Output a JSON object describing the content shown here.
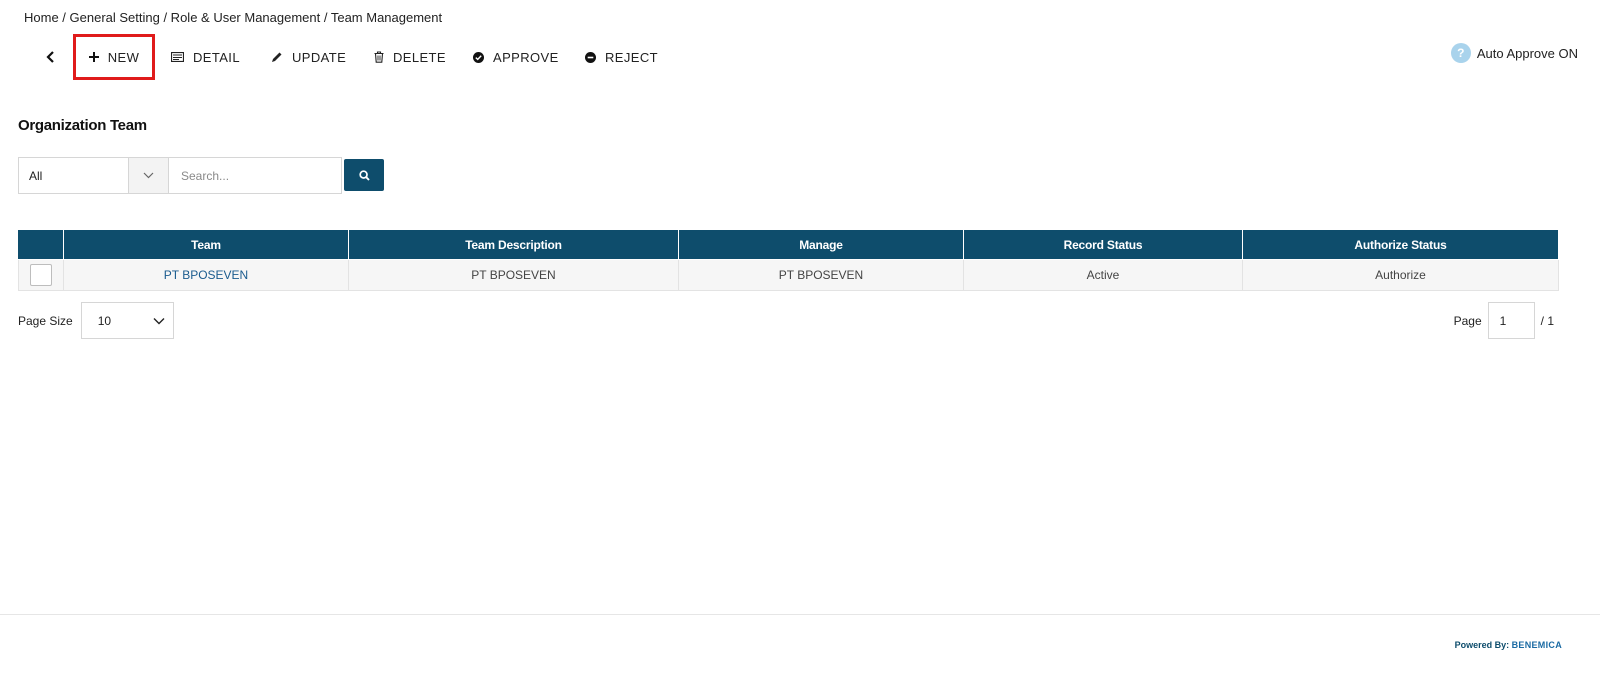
{
  "breadcrumb": "Home / General Setting / Role & User Management / Team Management",
  "toolbar": {
    "new_label": "NEW",
    "detail_label": "DETAIL",
    "update_label": "UPDATE",
    "delete_label": "DELETE",
    "approve_label": "APPROVE",
    "reject_label": "REJECT"
  },
  "auto_approve": {
    "icon": "?",
    "label": "Auto Approve ON"
  },
  "page_title": "Organization Team",
  "filter": {
    "selected": "All",
    "search_placeholder": "Search..."
  },
  "table": {
    "columns": [
      "Team",
      "Team Description",
      "Manage",
      "Record Status",
      "Authorize Status"
    ],
    "rows": [
      {
        "team": "PT BPOSEVEN",
        "description": "PT BPOSEVEN",
        "manage": "PT BPOSEVEN",
        "record_status": "Active",
        "authorize_status": "Authorize"
      }
    ]
  },
  "pagination": {
    "page_size_label": "Page Size",
    "page_size": "10",
    "page_label": "Page",
    "current_page": "1",
    "total_pages": "/ 1"
  },
  "footer": {
    "powered_by": "Powered By:",
    "brand": "BENEMICA"
  },
  "colors": {
    "primary": "#0e4d6c",
    "highlight": "#e01b1b",
    "link": "#1a5b8e",
    "help_icon": "#a9d3ec"
  }
}
